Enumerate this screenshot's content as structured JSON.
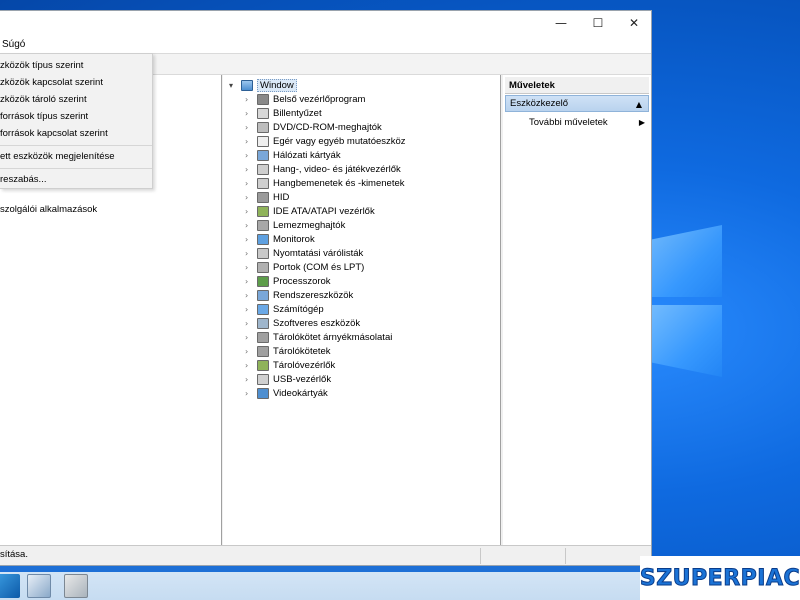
{
  "window": {
    "menu": [
      "Súgó"
    ],
    "controls": {
      "minimize": "—",
      "maximize": "☐",
      "close": "✕"
    }
  },
  "dropdown": {
    "items": [
      "Eszközök típus szerint",
      "Eszközök kapcsolat szerint",
      "Eszközök tároló szerint",
      "Erőforrások típus szerint",
      "Erőforrások kapcsolat szerint",
      "Rejtett eszközök megjelenítése",
      "Testreszabás..."
    ],
    "visible_labels": [
      "zközök típus szerint",
      "zközök kapcsolat szerint",
      "zközök tároló szerint",
      "források típus szerint",
      "források kapcsolat szerint",
      "ett eszközök megjelenítése",
      "reszabás..."
    ]
  },
  "left_pane": {
    "extra_label": "szolgálói alkalmazások"
  },
  "tree": {
    "root": "Window",
    "items": [
      "Belső vezérlőprogram",
      "Billentyűzet",
      "DVD/CD-ROM-meghajtók",
      "Egér vagy egyéb mutatóeszköz",
      "Hálózati kártyák",
      "Hang-, video- és játékvezérlők",
      "Hangbemenetek és -kimenetek",
      "HID",
      "IDE ATA/ATAPI vezérlők",
      "Lemezmeghajtók",
      "Monitorok",
      "Nyomtatási várólisták",
      "Portok (COM és LPT)",
      "Processzorok",
      "Rendszereszközök",
      "Számítógép",
      "Szoftveres eszközök",
      "Tárolókötet árnyékmásolatai",
      "Tárolókötetek",
      "Tárolóvezérlők",
      "USB-vezérlők",
      "Videokártyák"
    ]
  },
  "actions": {
    "header": "Műveletek",
    "section": "Eszközkezelő",
    "more": "További műveletek"
  },
  "status": {
    "text": "sítása."
  },
  "watermark": {
    "text": "SZUPERPIAC"
  },
  "colors": {
    "accent": "#1d6fd6",
    "selection": "#dbe9f7",
    "actions_section": "#cfe2f6"
  }
}
